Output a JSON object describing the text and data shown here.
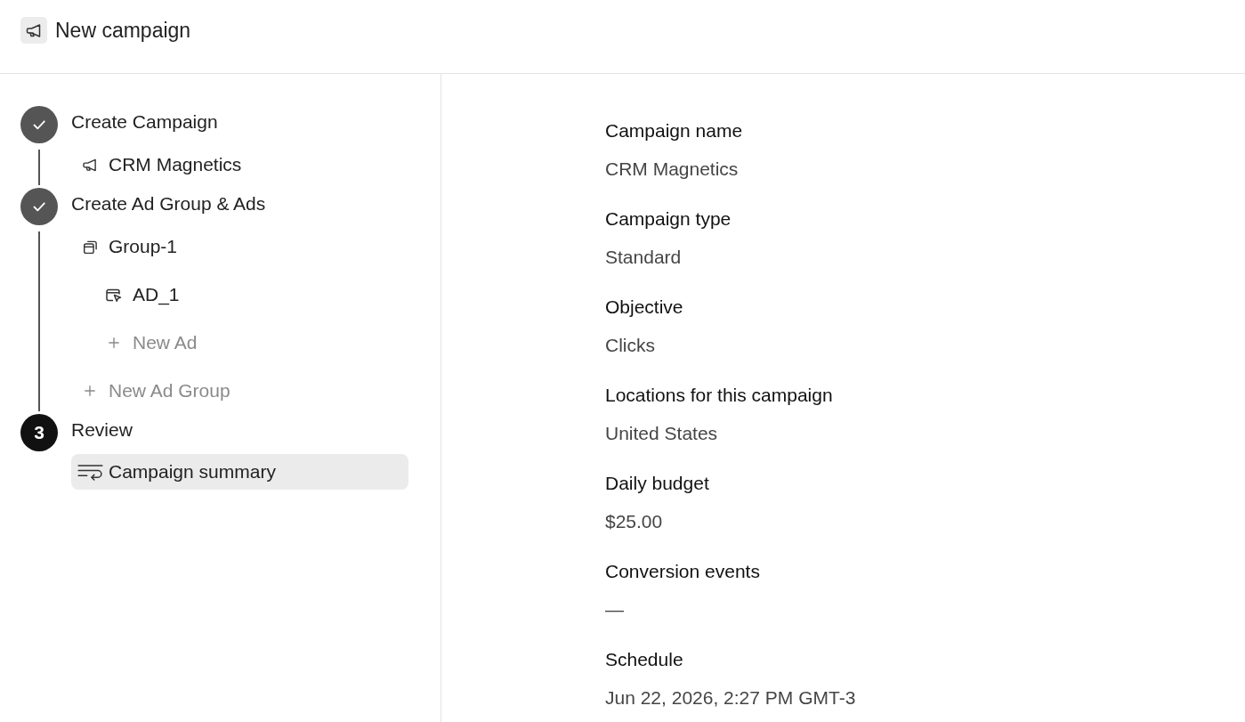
{
  "header": {
    "title": "New campaign"
  },
  "steps": [
    {
      "label": "Create Campaign",
      "complete": true,
      "children": [
        {
          "kind": "campaign",
          "label": "CRM Magnetics",
          "selected": false
        }
      ]
    },
    {
      "label": "Create Ad Group & Ads",
      "complete": true,
      "children": [
        {
          "kind": "group",
          "label": "Group-1",
          "selected": false,
          "children": [
            {
              "kind": "ad",
              "label": "AD_1",
              "selected": false
            },
            {
              "kind": "add",
              "label": "New Ad",
              "selected": false
            }
          ]
        },
        {
          "kind": "add",
          "label": "New Ad Group",
          "selected": false
        }
      ]
    },
    {
      "label": "Review",
      "complete": false,
      "number": "3",
      "children": [
        {
          "kind": "summary",
          "label": "Campaign summary",
          "selected": true
        }
      ]
    }
  ],
  "summary": {
    "fields": [
      {
        "label": "Campaign name",
        "value": "CRM Magnetics"
      },
      {
        "label": "Campaign type",
        "value": "Standard"
      },
      {
        "label": "Objective",
        "value": "Clicks"
      },
      {
        "label": "Locations for this campaign",
        "value": "United States"
      },
      {
        "label": "Daily budget",
        "value": "$25.00"
      },
      {
        "label": "Conversion events",
        "value": "—"
      },
      {
        "label": "Schedule",
        "value": "Jun 22, 2026, 2:27 PM GMT-3"
      }
    ]
  }
}
